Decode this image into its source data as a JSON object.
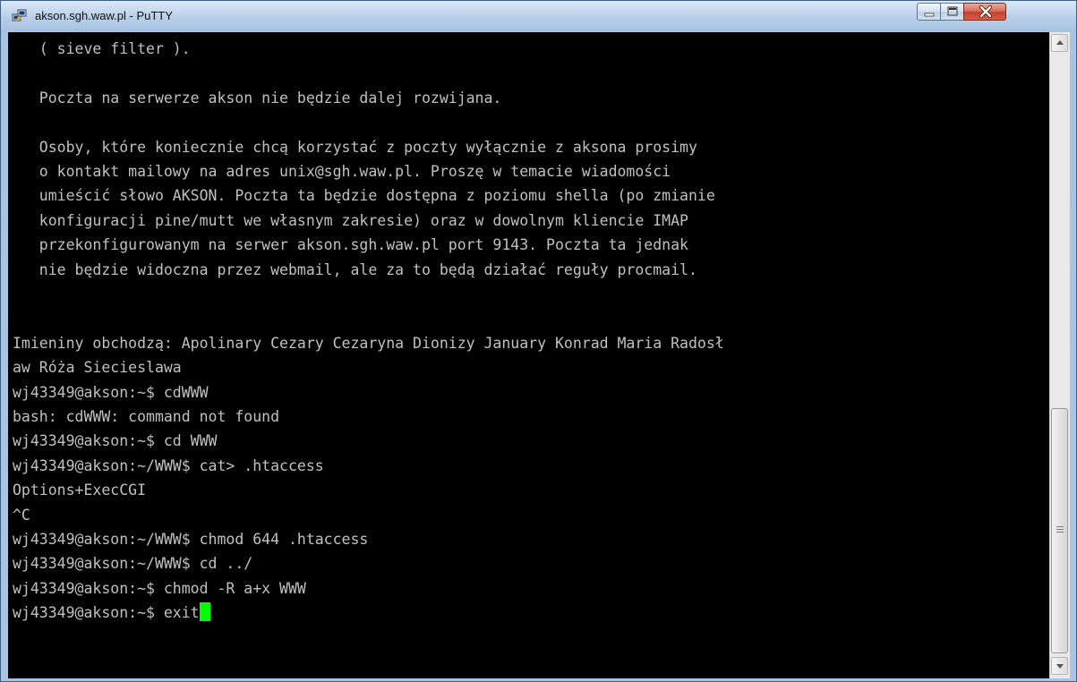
{
  "window": {
    "title": "akson.sgh.waw.pl - PuTTY",
    "icons": {
      "app": "putty-icon",
      "minimize": "minimize-icon",
      "maximize": "maximize-icon",
      "close": "close-icon"
    }
  },
  "terminal": {
    "lines": [
      "   ( sieve filter ).",
      "",
      "   Poczta na serwerze akson nie będzie dalej rozwijana.",
      "",
      "   Osoby, które koniecznie chcą korzystać z poczty wyłącznie z aksona prosimy",
      "   o kontakt mailowy na adres unix@sgh.waw.pl. Proszę w temacie wiadomości",
      "   umieścić słowo AKSON. Poczta ta będzie dostępna z poziomu shella (po zmianie",
      "   konfiguracji pine/mutt we własnym zakresie) oraz w dowolnym kliencie IMAP",
      "   przekonfigurowanym na serwer akson.sgh.waw.pl port 9143. Poczta ta jednak",
      "   nie będzie widoczna przez webmail, ale za to będą działać reguły procmail.",
      "",
      "",
      "Imieniny obchodzą: Apolinary Cezary Cezaryna Dionizy January Konrad Maria Radosł",
      "aw Róża Siecieslawa",
      "wj43349@akson:~$ cdWWW",
      "bash: cdWWW: command not found",
      "wj43349@akson:~$ cd WWW",
      "wj43349@akson:~/WWW$ cat> .htaccess",
      "Options+ExecCGI",
      "^C",
      "wj43349@akson:~/WWW$ chmod 644 .htaccess",
      "wj43349@akson:~/WWW$ cd ../",
      "wj43349@akson:~$ chmod -R a+x WWW",
      "wj43349@akson:~$ exit"
    ],
    "cursor_color": "#00ff00",
    "text_color": "#c0c0c0",
    "background": "#000000"
  },
  "scrollbar": {
    "position": 0.58
  }
}
